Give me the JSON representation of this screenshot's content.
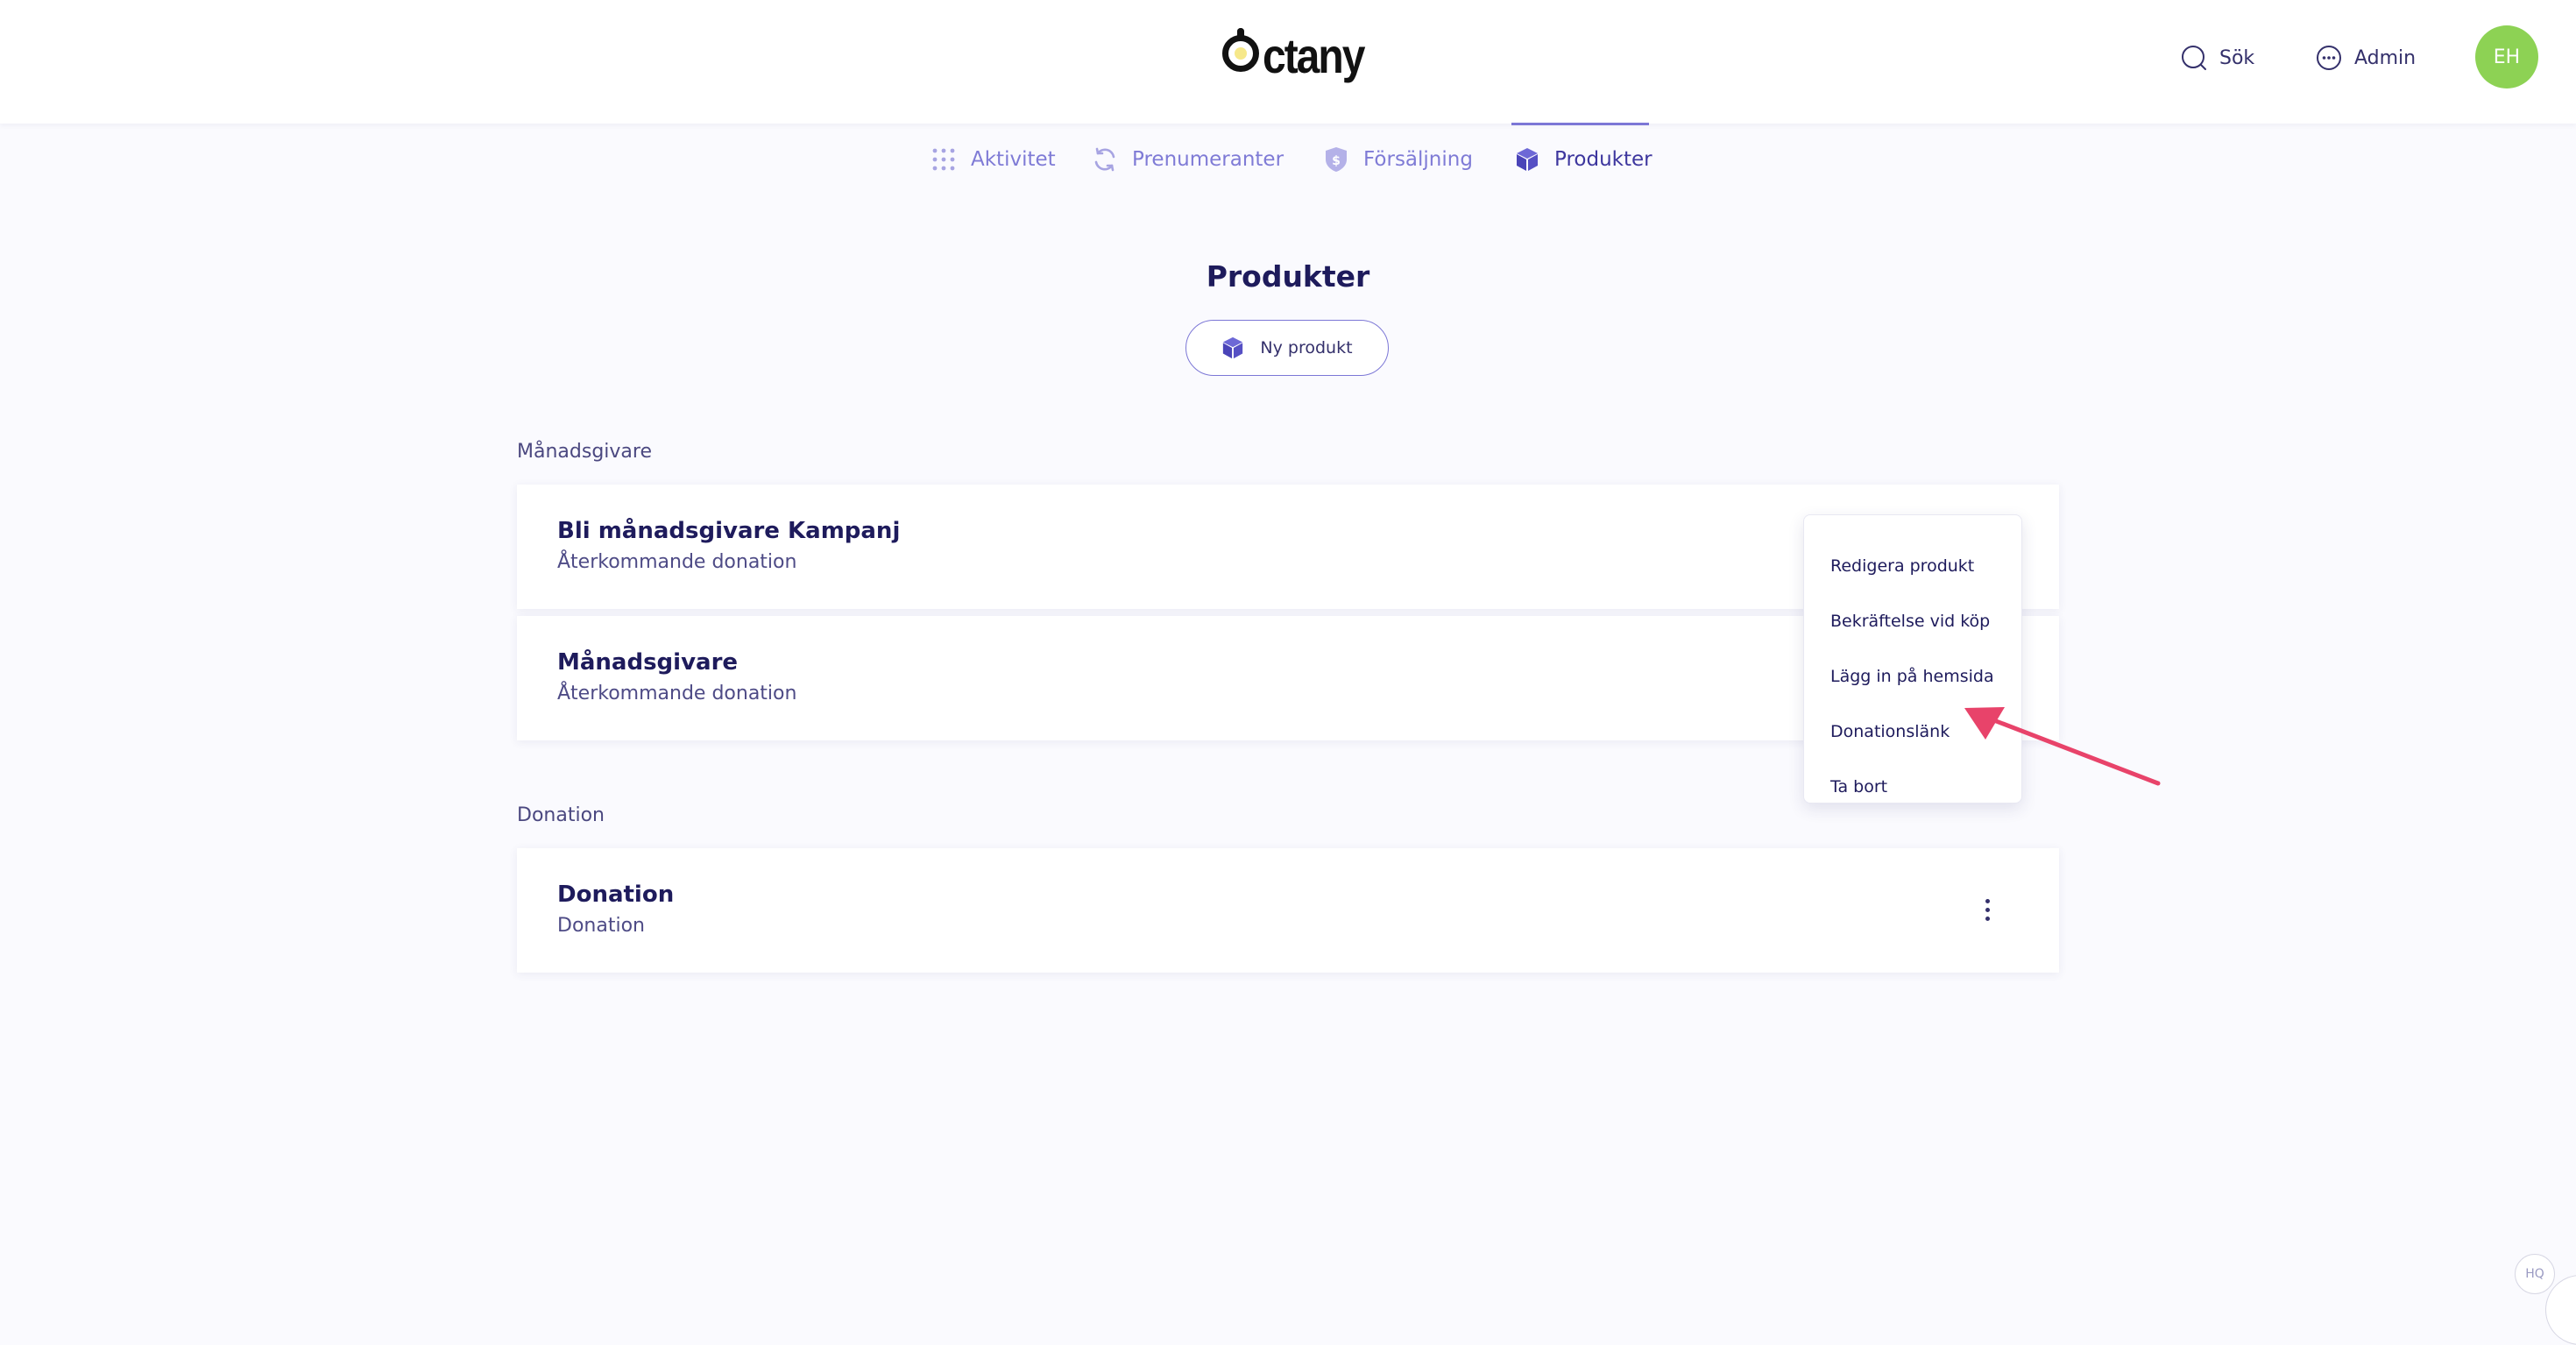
{
  "header": {
    "logo_text": "ctany",
    "search_label": "Sök",
    "admin_label": "Admin",
    "avatar_initials": "EH"
  },
  "nav": {
    "tabs": [
      {
        "label": "Aktivitet",
        "icon": "grid-dots-icon"
      },
      {
        "label": "Prenumeranter",
        "icon": "refresh-icon"
      },
      {
        "label": "Försäljning",
        "icon": "dollar-shield-icon"
      },
      {
        "label": "Produkter",
        "icon": "box-icon",
        "active": true
      }
    ]
  },
  "page": {
    "title": "Produkter",
    "new_product_label": "Ny produkt"
  },
  "sections": [
    {
      "label": "Månadsgivare",
      "products": [
        {
          "name": "Bli månadsgivare Kampanj",
          "type": "Återkommande donation"
        },
        {
          "name": "Månadsgivare",
          "type": "Återkommande donation"
        }
      ]
    },
    {
      "label": "Donation",
      "products": [
        {
          "name": "Donation",
          "type": "Donation"
        }
      ]
    }
  ],
  "menu": {
    "items": [
      "Redigera produkt",
      "Bekräftelse vid köp",
      "Lägg in på hemsida",
      "Donationslänk",
      "Ta bort"
    ]
  },
  "widget": {
    "hq_label": "HQ"
  },
  "colors": {
    "accent": "#7c77d6",
    "text_dark": "#1e1b5c",
    "avatar_bg": "#8dd254",
    "arrow": "#e8436a",
    "background": "#fafafe"
  }
}
